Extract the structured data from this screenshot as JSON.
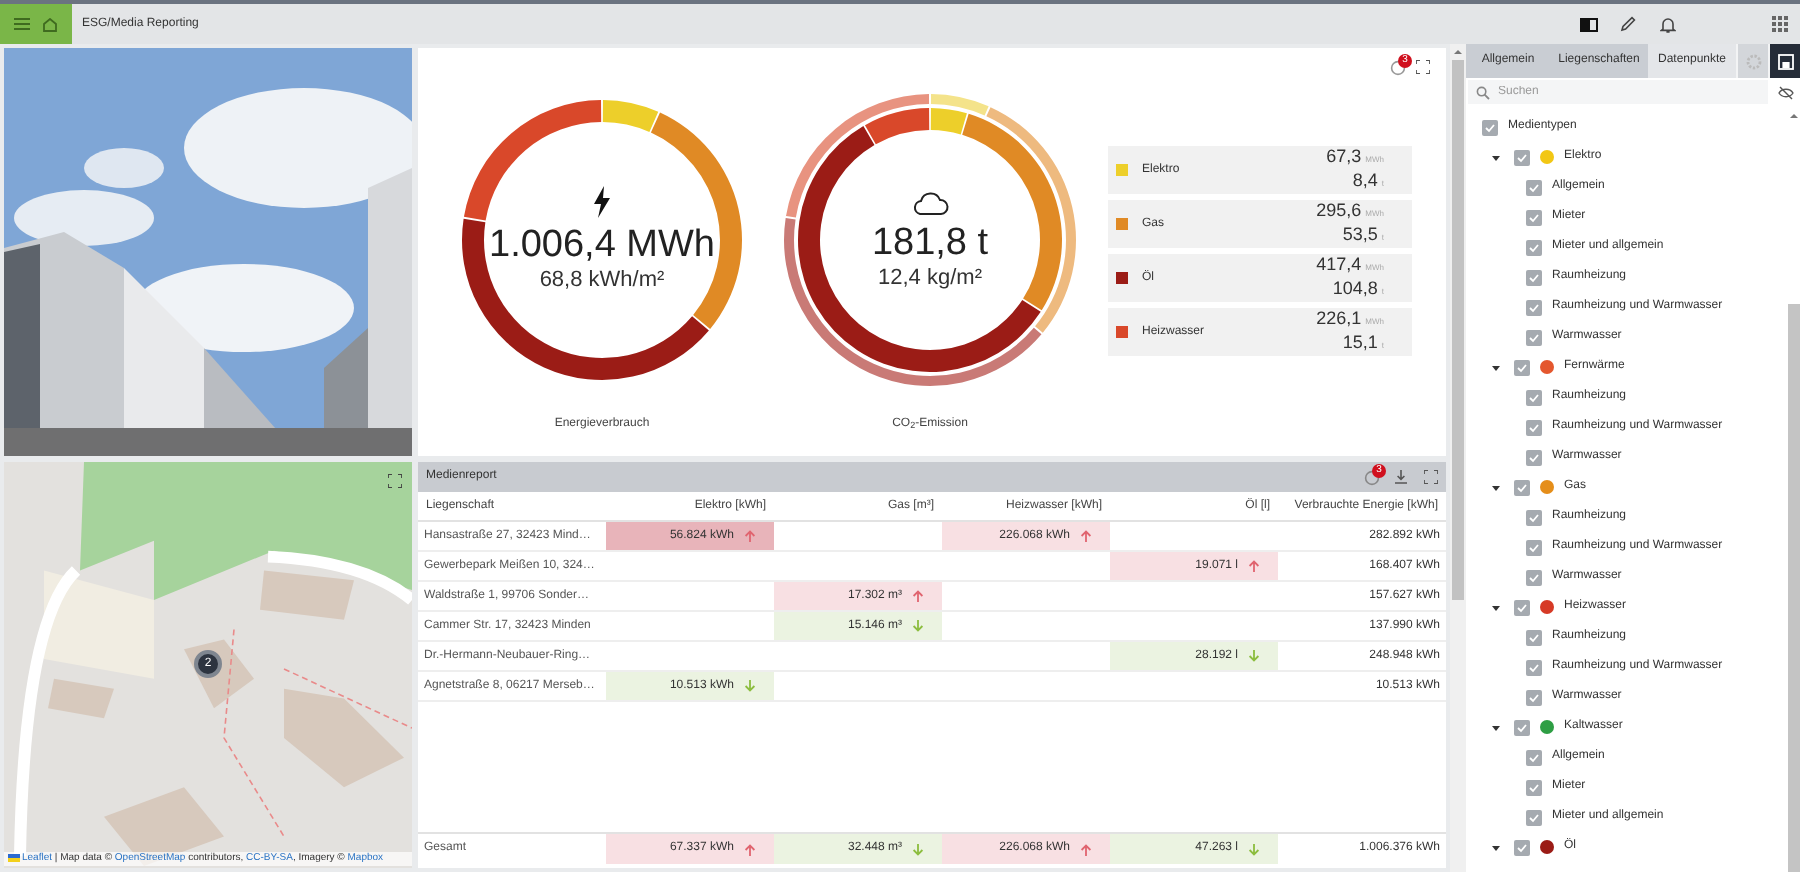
{
  "header": {
    "title": "ESG/Media Reporting"
  },
  "map": {
    "kind": "picture",
    "marker_count": "2",
    "attribution": [
      {
        "text": "Leaflet",
        "link": true
      },
      {
        "text": " | Map data © ",
        "link": false
      },
      {
        "text": "OpenStreetMap",
        "link": true
      },
      {
        "text": " contributors, ",
        "link": false
      },
      {
        "text": "CC-BY-SA",
        "link": true
      },
      {
        "text": ", Imagery © ",
        "link": false
      },
      {
        "text": "Mapbox",
        "link": true
      }
    ]
  },
  "charts_panel": {
    "badge": "3",
    "charts": [
      {
        "total": "1.006,4 MWh",
        "per_area": "68,8 kWh/m²",
        "caption": "Energieverbrauch",
        "chart_data": {
          "type": "donut",
          "series": [
            {
              "colors": [
                "#edcf2a",
                "#e08a25",
                "#9b1c16",
                "#d9482a"
              ],
              "values": [
                6.69,
                29.37,
                41.47,
                22.47
              ]
            }
          ]
        }
      },
      {
        "total": "181,8 t",
        "per_area": "12,4 kg/m²",
        "caption": "CO$_{2}$-Emission",
        "chart_data": {
          "type": "donut",
          "series": [
            {
              "colors": [
                "#edcf2a",
                "#e08a25",
                "#9b1c16",
                "#d9482a"
              ],
              "values": [
                4.62,
                29.43,
                57.64,
                8.31
              ]
            },
            {
              "colors": [
                "#f4e38a",
                "#eeba7f",
                "#c97a76",
                "#e89380"
              ],
              "values": [
                6.69,
                29.37,
                41.47,
                22.47
              ]
            }
          ]
        }
      }
    ],
    "legend": [
      {
        "label": "Elektro",
        "color": "#edcf2a",
        "energy": "67,3",
        "energy_unit": "MWh",
        "co2": "8,4",
        "co2_unit": "t"
      },
      {
        "label": "Gas",
        "color": "#e08a25",
        "energy": "295,6",
        "energy_unit": "MWh",
        "co2": "53,5",
        "co2_unit": "t"
      },
      {
        "label": "Öl",
        "color": "#9b1c16",
        "energy": "417,4",
        "energy_unit": "MWh",
        "co2": "104,8",
        "co2_unit": "t"
      },
      {
        "label": "Heizwasser",
        "color": "#d9482a",
        "energy": "226,1",
        "energy_unit": "MWh",
        "co2": "15,1",
        "co2_unit": "t"
      }
    ]
  },
  "table": {
    "title": "Medienreport",
    "badge": "3",
    "columns": [
      "Liegenschaft",
      "Elektro [kWh]",
      "Gas [m³]",
      "Heizwasser [kWh]",
      "Öl [l]",
      "Verbrauchte Energie [kWh]"
    ],
    "rows": [
      {
        "cells": [
          {
            "text": "Hansastraße 27, 32423 Mind…"
          },
          {
            "text": "56.824 kWh",
            "rising": true,
            "strong": true
          },
          null,
          {
            "text": "226.068 kWh",
            "rising": true,
            "strong": false
          },
          null,
          {
            "text": "282.892 kWh"
          }
        ]
      },
      {
        "cells": [
          {
            "text": "Gewerbepark Meißen 10, 324…"
          },
          null,
          null,
          null,
          {
            "text": "19.071 l",
            "rising": true,
            "strong": false
          },
          {
            "text": "168.407 kWh"
          }
        ]
      },
      {
        "cells": [
          {
            "text": "Waldstraße 1, 99706 Sonder…"
          },
          null,
          {
            "text": "17.302 m³",
            "rising": true,
            "strong": false
          },
          null,
          null,
          {
            "text": "157.627 kWh"
          }
        ]
      },
      {
        "cells": [
          {
            "text": "Cammer Str. 17, 32423 Minden"
          },
          null,
          {
            "text": "15.146 m³",
            "rising": false,
            "strong": false
          },
          null,
          null,
          {
            "text": "137.990 kWh"
          }
        ]
      },
      {
        "cells": [
          {
            "text": "Dr.-Hermann-Neubauer-Ring…"
          },
          null,
          null,
          null,
          {
            "text": "28.192 l",
            "rising": false,
            "strong": false
          },
          {
            "text": "248.948 kWh"
          }
        ]
      },
      {
        "cells": [
          {
            "text": "Agnetstraße 8, 06217 Merseb…"
          },
          {
            "text": "10.513 kWh",
            "rising": false,
            "strong": false
          },
          null,
          null,
          null,
          {
            "text": "10.513 kWh"
          }
        ]
      }
    ],
    "total": {
      "cells": [
        {
          "text": "Gesamt"
        },
        {
          "text": "67.337 kWh",
          "rising": true,
          "strong": false
        },
        {
          "text": "32.448 m³",
          "rising": false,
          "strong": false
        },
        {
          "text": "226.068 kWh",
          "rising": true,
          "strong": false
        },
        {
          "text": "47.263 l",
          "rising": false,
          "strong": false
        },
        {
          "text": "1.006.376 kWh"
        }
      ]
    }
  },
  "sidebar": {
    "tabs": [
      {
        "label": "Allgemein",
        "selected": false
      },
      {
        "label": "Liegenschaften",
        "selected": false
      },
      {
        "label": "Datenpunkte",
        "selected": true
      }
    ],
    "search": {
      "placeholder": "Suchen"
    },
    "tree": [
      {
        "label": "Medientypen",
        "checked": true,
        "children": [
          {
            "label": "Elektro",
            "checked": true,
            "expanded": true,
            "color": "#f2c714",
            "children": [
              {
                "label": "Allgemein",
                "checked": true
              },
              {
                "label": "Mieter",
                "checked": true
              },
              {
                "label": "Mieter und allgemein",
                "checked": true
              },
              {
                "label": "Raumheizung",
                "checked": true
              },
              {
                "label": "Raumheizung und Warmwasser",
                "checked": true
              },
              {
                "label": "Warmwasser",
                "checked": true
              }
            ]
          },
          {
            "label": "Fernwärme",
            "checked": true,
            "expanded": true,
            "color": "#e4572e",
            "children": [
              {
                "label": "Raumheizung",
                "checked": true
              },
              {
                "label": "Raumheizung und Warmwasser",
                "checked": true
              },
              {
                "label": "Warmwasser",
                "checked": true
              }
            ]
          },
          {
            "label": "Gas",
            "checked": true,
            "expanded": true,
            "color": "#e58e1a",
            "children": [
              {
                "label": "Raumheizung",
                "checked": true
              },
              {
                "label": "Raumheizung und Warmwasser",
                "checked": true
              },
              {
                "label": "Warmwasser",
                "checked": true
              }
            ]
          },
          {
            "label": "Heizwasser",
            "checked": true,
            "expanded": true,
            "color": "#d63a26",
            "children": [
              {
                "label": "Raumheizung",
                "checked": true
              },
              {
                "label": "Raumheizung und Warmwasser",
                "checked": true
              },
              {
                "label": "Warmwasser",
                "checked": true
              }
            ]
          },
          {
            "label": "Kaltwasser",
            "checked": true,
            "expanded": true,
            "color": "#2e9e44",
            "children": [
              {
                "label": "Allgemein",
                "checked": true
              },
              {
                "label": "Mieter",
                "checked": true
              },
              {
                "label": "Mieter und allgemein",
                "checked": true
              }
            ]
          },
          {
            "label": "Öl",
            "checked": true,
            "expanded": true,
            "color": "#9b1c16"
          }
        ]
      }
    ]
  }
}
